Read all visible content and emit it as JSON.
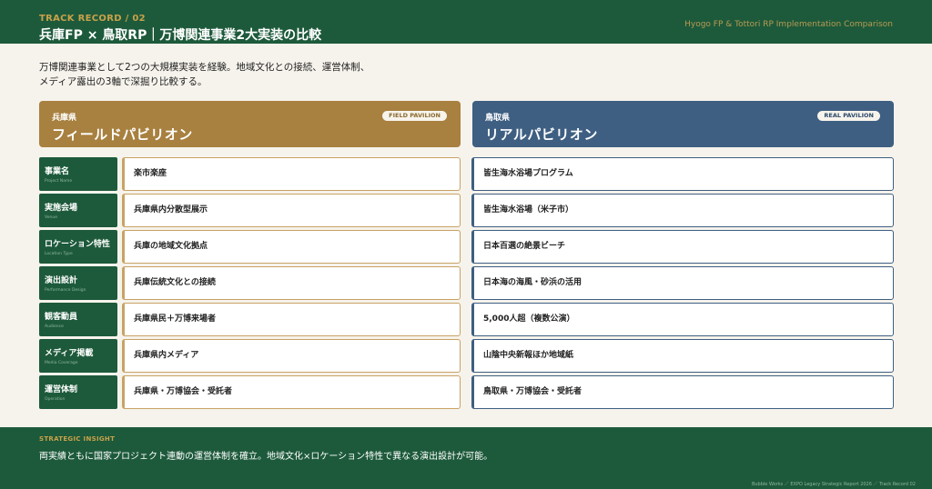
{
  "header": {
    "kicker": "TRACK RECORD / 02",
    "title": "兵庫FP × 鳥取RP｜万博関連事業2大実装の比較",
    "subtitle_en": "Hyogo FP & Tottori RP Implementation Comparison"
  },
  "intro": {
    "line1": "万博関連事業として2つの大規模実装を経験。地域文化との接続、運営体制、",
    "line2": "メディア露出の3軸で深掘り比較する。"
  },
  "columns": {
    "left": {
      "prefecture": "兵庫県",
      "name": "フィールドパビリオン",
      "badge": "FIELD PAVILION",
      "color": "#a8803f"
    },
    "right": {
      "prefecture": "鳥取県",
      "name": "リアルパビリオン",
      "badge": "REAL PAVILION",
      "color": "#3e5f82"
    }
  },
  "rows": [
    {
      "label": "事業名",
      "label_en": "Project Name",
      "left": "楽市楽座",
      "right": "皆生海水浴場プログラム"
    },
    {
      "label": "実施会場",
      "label_en": "Venue",
      "left": "兵庫県内分散型展示",
      "right": "皆生海水浴場（米子市）"
    },
    {
      "label": "ロケーション特性",
      "label_en": "Location Type",
      "left": "兵庫の地域文化拠点",
      "right": "日本百選の絶景ビーチ"
    },
    {
      "label": "演出設計",
      "label_en": "Performance Design",
      "left": "兵庫伝統文化との接続",
      "right": "日本海の海風・砂浜の活用"
    },
    {
      "label": "観客動員",
      "label_en": "Audience",
      "left": "兵庫県民＋万博来場者",
      "right": "5,000人超（複数公演）"
    },
    {
      "label": "メディア掲載",
      "label_en": "Media Coverage",
      "left": "兵庫県内メディア",
      "right": "山陰中央新報ほか地域紙"
    },
    {
      "label": "運営体制",
      "label_en": "Operation",
      "left": "兵庫県・万博協会・受託者",
      "right": "鳥取県・万博協会・受託者"
    }
  ],
  "footer": {
    "insight_label": "STRATEGIC INSIGHT",
    "insight_text": "両実績ともに国家プロジェクト連動の運営体制を確立。地域文化×ロケーション特性で異なる演出設計が可能。",
    "credit": "Bubble Works ／ EXPO Legacy Strategic Report 2026 ／ Track Record 02"
  },
  "colors": {
    "primary_green": "#1d5a3b",
    "gold": "#c9a14a",
    "background": "#f6f3ec"
  }
}
